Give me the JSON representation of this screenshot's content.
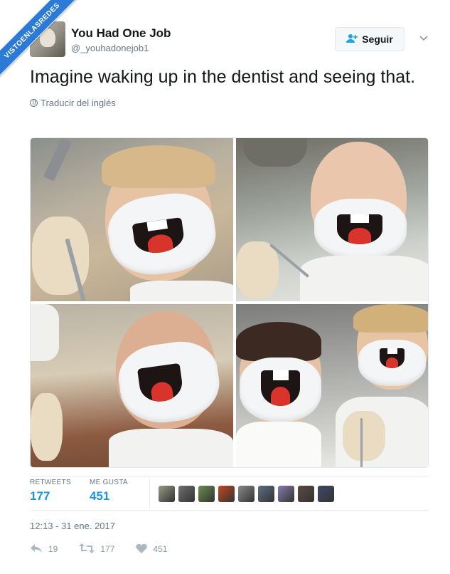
{
  "watermark": {
    "text": "VISTOENLASREDES"
  },
  "user": {
    "display_name": "You Had One Job",
    "handle": "@_youhadonejob1"
  },
  "follow_button": {
    "label": "Seguir",
    "icon": "add-user-icon"
  },
  "tweet": {
    "text": "Imagine waking up in the dentist and seeing that.",
    "translate_label": "Traducir del inglés"
  },
  "stats": {
    "retweets_label": "RETWEETS",
    "retweets_value": "177",
    "likes_label": "ME GUSTA",
    "likes_value": "451",
    "likers": [
      {
        "color": "#9a9a84"
      },
      {
        "color": "#6f6f6f"
      },
      {
        "color": "#6b8f4e"
      },
      {
        "color": "#c24a1f"
      },
      {
        "color": "#8a8a8a"
      },
      {
        "color": "#5c6f86"
      },
      {
        "color": "#8a7ab0"
      },
      {
        "color": "#5a4a40"
      },
      {
        "color": "#3e4a6a"
      }
    ]
  },
  "timestamp": "12:13 - 31 ene. 2017",
  "actions": {
    "reply_count": "19",
    "retweet_count": "177",
    "like_count": "451"
  },
  "colors": {
    "accent": "#1b95e0",
    "ribbon": "#2b7bd6"
  }
}
